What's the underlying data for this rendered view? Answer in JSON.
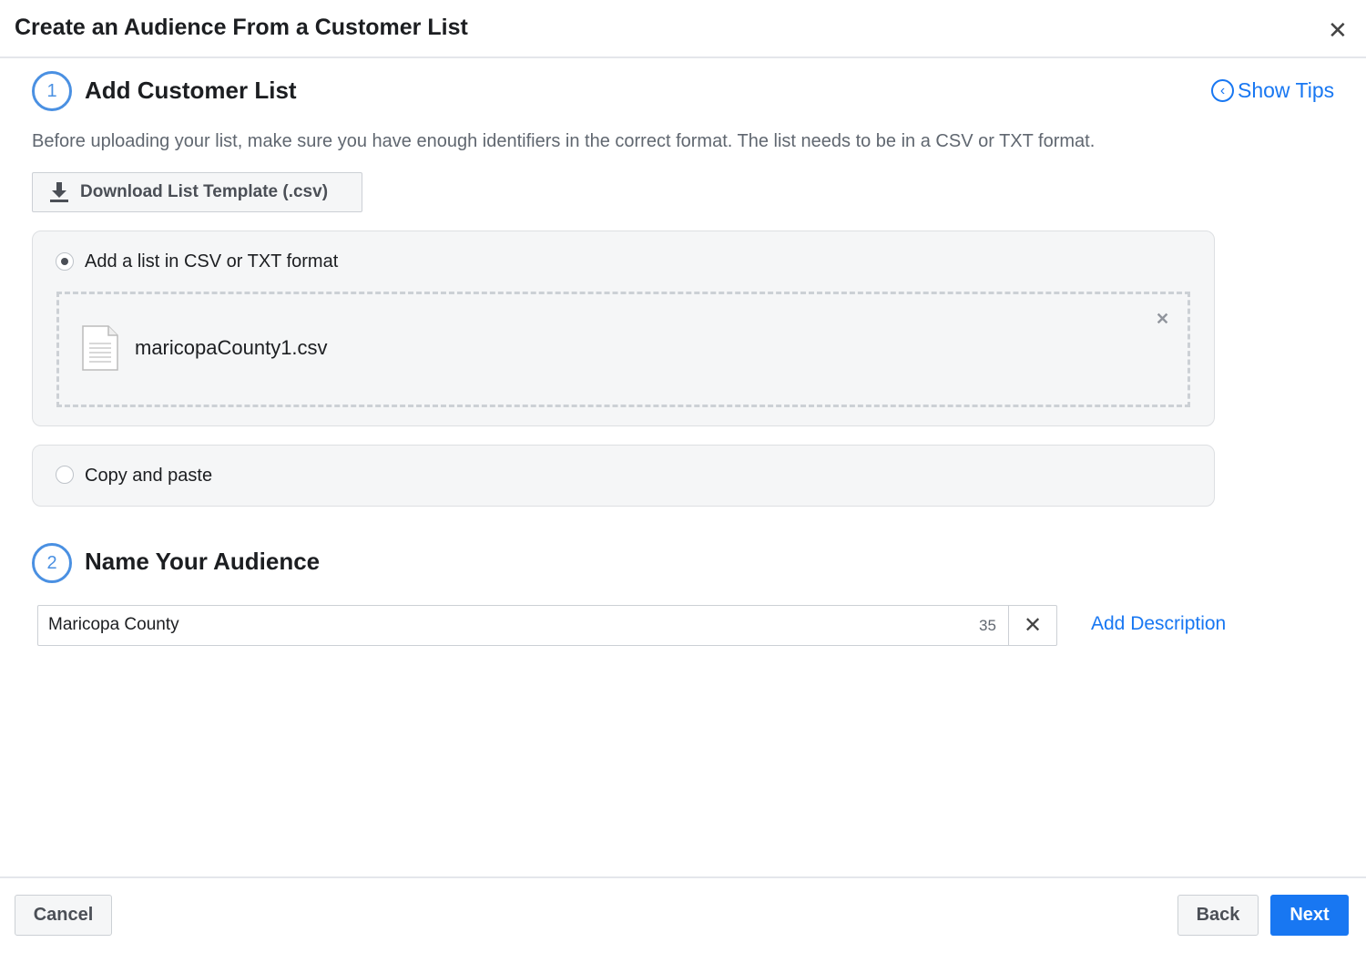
{
  "dialog": {
    "title": "Create an Audience From a Customer List",
    "close_icon": "close-icon"
  },
  "step1": {
    "number": "1",
    "title": "Add Customer List",
    "show_tips": "Show Tips",
    "description": "Before uploading your list, make sure you have enough identifiers in the correct format. The list needs to be in a CSV or TXT format.",
    "download_label": "Download List Template (.csv)",
    "option_file": {
      "label": "Add a list in CSV or TXT format",
      "selected": true
    },
    "file_name": "maricopaCounty1.csv",
    "option_paste": {
      "label": "Copy and paste",
      "selected": false
    }
  },
  "step2": {
    "number": "2",
    "title": "Name Your Audience",
    "name_value": "Maricopa County",
    "char_count": "35",
    "add_description": "Add Description"
  },
  "footer": {
    "cancel": "Cancel",
    "back": "Back",
    "next": "Next"
  },
  "colors": {
    "accent": "#1877f2",
    "step_circle": "#4a90e2"
  }
}
